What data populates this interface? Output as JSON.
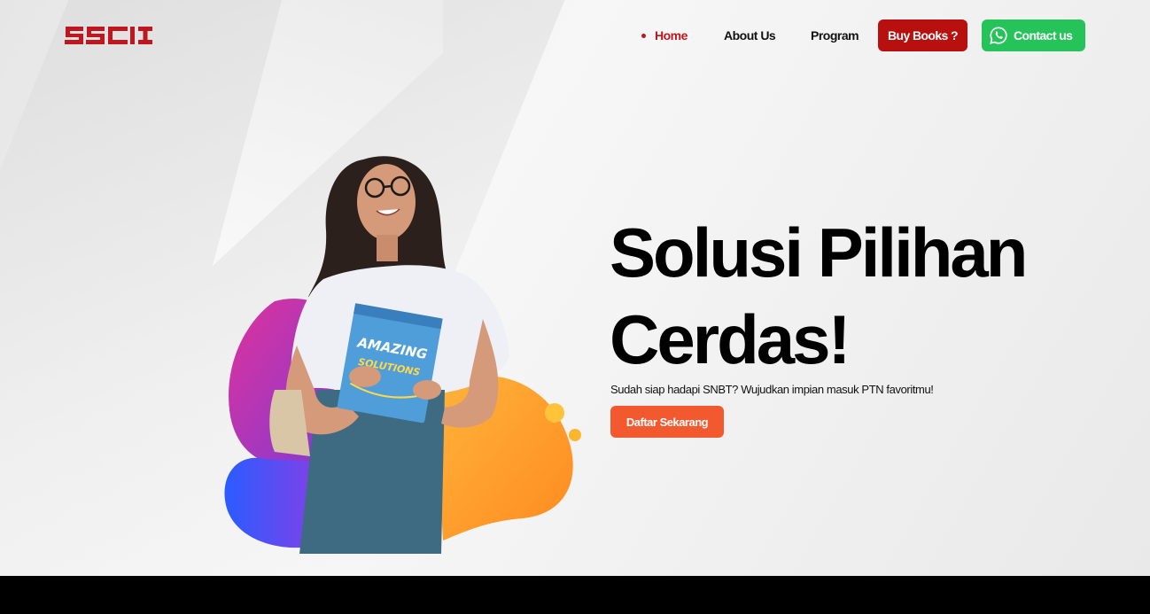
{
  "brand": {
    "logo_text": "SSCI",
    "color": "#c0161d"
  },
  "nav": {
    "home": "Home",
    "about": "About Us",
    "program": "Program",
    "buy_books": "Buy Books ?",
    "contact": "Contact us"
  },
  "hero": {
    "headline_line1": "Solusi Pilihan",
    "headline_line2": "Cerdas!",
    "subline": "Sudah siap hadapi SNBT? Wujudkan impian masuk PTN favoritmu!",
    "cta": "Daftar Sekarang",
    "book_text": "AMAZING SOLUTIONS"
  },
  "colors": {
    "accent_red": "#b80f0f",
    "whatsapp_green": "#25c35a",
    "cta_orange": "#f2592f"
  },
  "icons": [
    "whatsapp-icon"
  ]
}
